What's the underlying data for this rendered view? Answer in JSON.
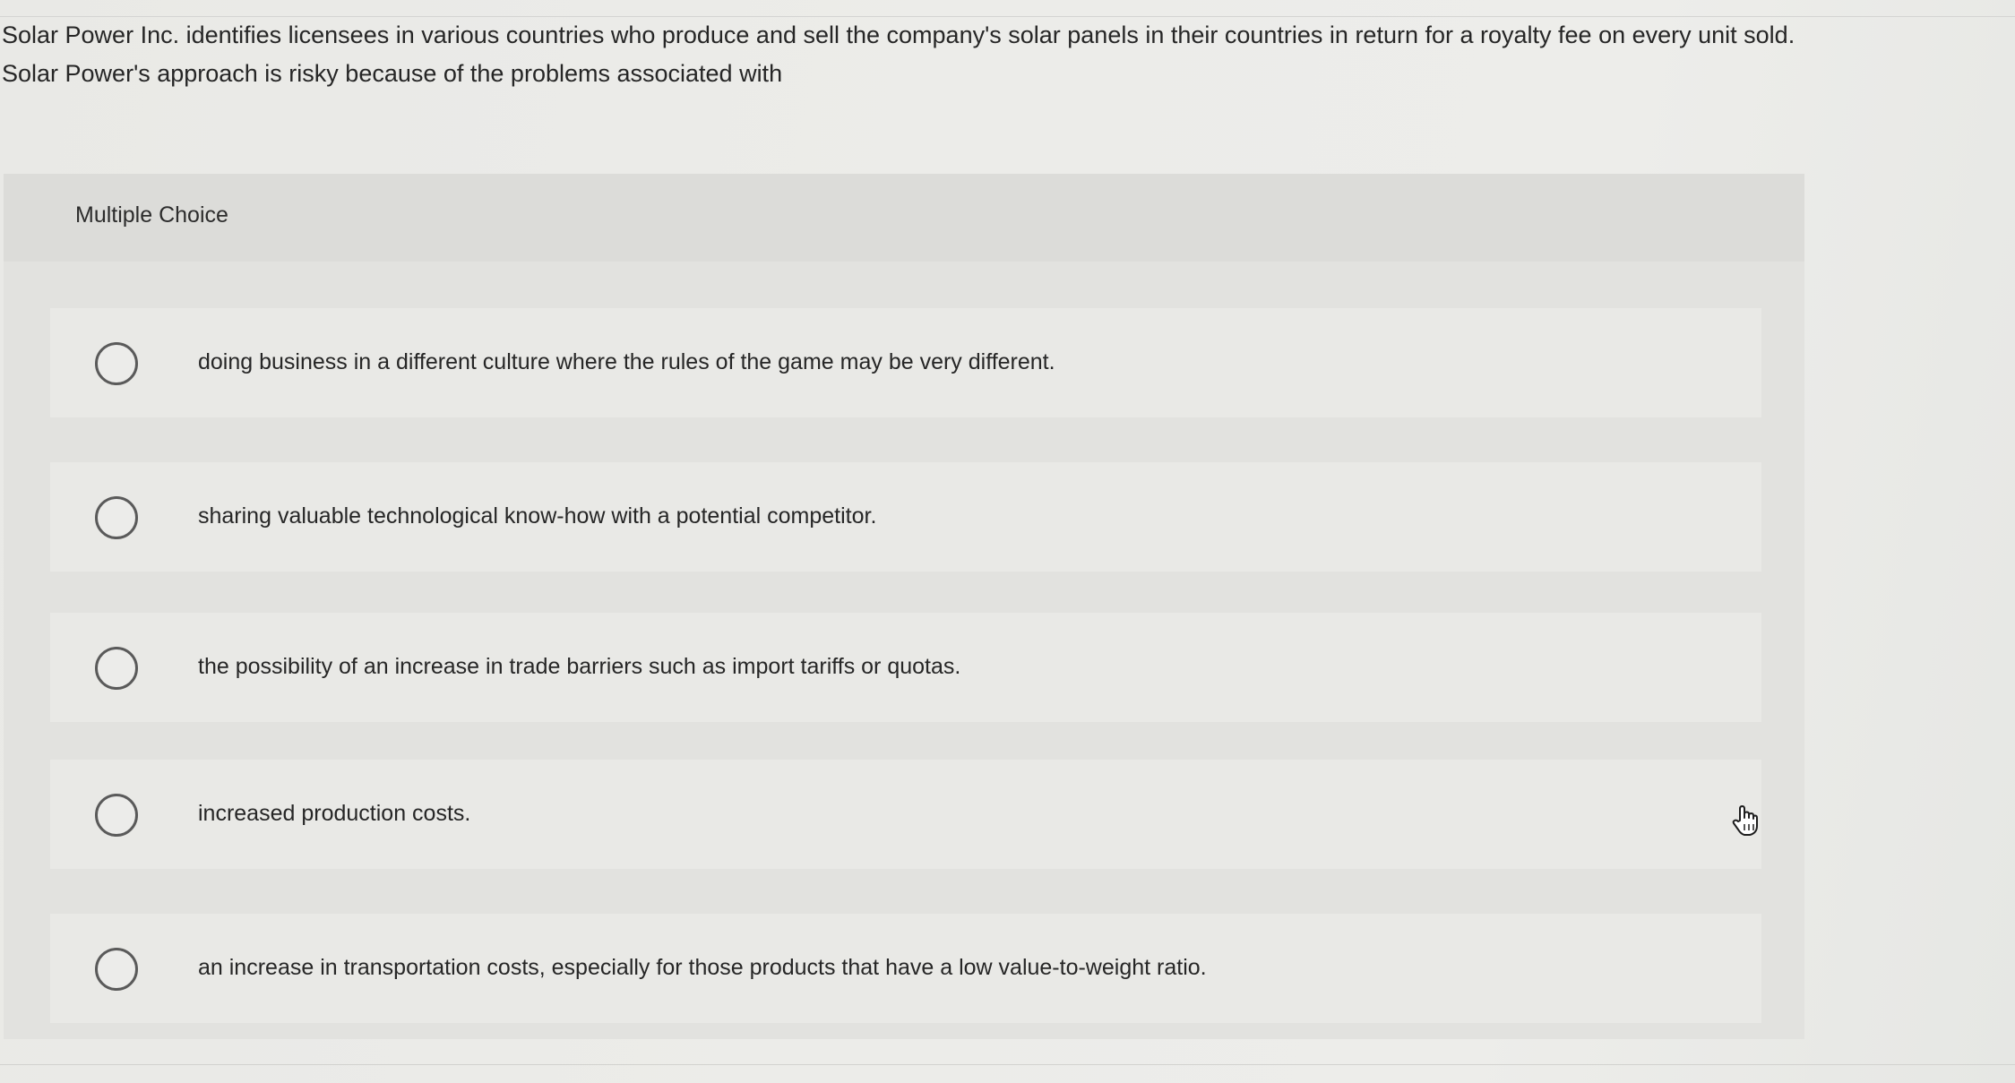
{
  "question": {
    "text": "Solar Power Inc. identifies licensees in various countries who produce and sell the company's solar panels in their countries in return for a royalty fee on every unit sold. Solar Power's approach is risky because of the problems associated with"
  },
  "multiple_choice": {
    "header_label": "Multiple Choice",
    "options": [
      {
        "label": "doing business in a different culture where the rules of the game may be very different."
      },
      {
        "label": "sharing valuable technological know-how with a potential competitor."
      },
      {
        "label": "the possibility of an increase in trade barriers such as import tariffs or quotas."
      },
      {
        "label": "increased production costs."
      },
      {
        "label": "an increase in transportation costs, especially for those products that have a low value-to-weight ratio."
      }
    ]
  },
  "cursor": {
    "icon": "hand-pointer-icon"
  },
  "colors": {
    "radio_border": "#5a5a5a",
    "panel_bg": "#e2e2df",
    "option_bg": "#e9e9e6"
  }
}
